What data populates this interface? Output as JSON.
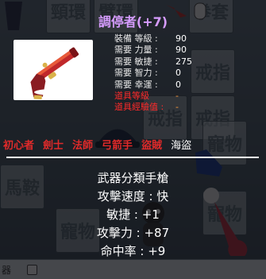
{
  "background": {
    "slot_labels": [
      "頸環",
      "臂環",
      "拳套",
      "臂帶",
      "戒指",
      "戒指",
      "戒指",
      "寵物",
      "馬鞍",
      "寵物",
      "寵物"
    ],
    "bottom_bar_label": "器"
  },
  "tooltip": {
    "title": "調停者(+7)",
    "requirements": [
      {
        "label": "裝備 等級 :",
        "value": "90"
      },
      {
        "label": "需要 力量 :",
        "value": "90"
      },
      {
        "label": "需要 敏捷 :",
        "value": "275"
      },
      {
        "label": "需要 智力 :",
        "value": "0"
      },
      {
        "label": "需要 幸運 :",
        "value": "0"
      },
      {
        "label": "道具等級",
        "value": "-"
      },
      {
        "label": "道具經驗值 :",
        "value": "-"
      }
    ],
    "jobs": [
      "初心者",
      "劍士",
      "法師",
      "弓箭手",
      "盜賊",
      "海盜"
    ],
    "details": [
      "武器分類手槍",
      "攻擊速度 : 快",
      "敏捷 : +1",
      "攻擊力 : +87",
      "命中率 : +9"
    ]
  },
  "colors": {
    "title": "#d69cff",
    "job_unavailable": "#e02a2a",
    "job_available": "#ffffff",
    "requirement_fail": "#ff2a2a"
  }
}
